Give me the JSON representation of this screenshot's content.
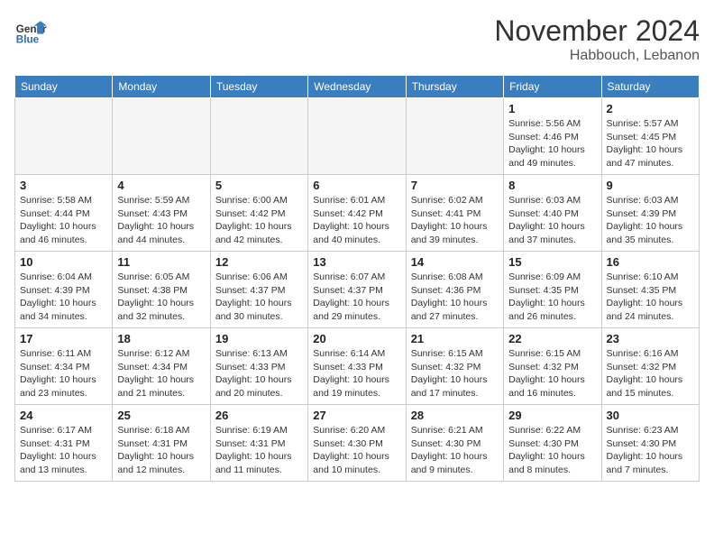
{
  "header": {
    "logo_general": "General",
    "logo_blue": "Blue",
    "month": "November 2024",
    "location": "Habbouch, Lebanon"
  },
  "days_of_week": [
    "Sunday",
    "Monday",
    "Tuesday",
    "Wednesday",
    "Thursday",
    "Friday",
    "Saturday"
  ],
  "weeks": [
    [
      {
        "day": "",
        "info": ""
      },
      {
        "day": "",
        "info": ""
      },
      {
        "day": "",
        "info": ""
      },
      {
        "day": "",
        "info": ""
      },
      {
        "day": "",
        "info": ""
      },
      {
        "day": "1",
        "info": "Sunrise: 5:56 AM\nSunset: 4:46 PM\nDaylight: 10 hours\nand 49 minutes."
      },
      {
        "day": "2",
        "info": "Sunrise: 5:57 AM\nSunset: 4:45 PM\nDaylight: 10 hours\nand 47 minutes."
      }
    ],
    [
      {
        "day": "3",
        "info": "Sunrise: 5:58 AM\nSunset: 4:44 PM\nDaylight: 10 hours\nand 46 minutes."
      },
      {
        "day": "4",
        "info": "Sunrise: 5:59 AM\nSunset: 4:43 PM\nDaylight: 10 hours\nand 44 minutes."
      },
      {
        "day": "5",
        "info": "Sunrise: 6:00 AM\nSunset: 4:42 PM\nDaylight: 10 hours\nand 42 minutes."
      },
      {
        "day": "6",
        "info": "Sunrise: 6:01 AM\nSunset: 4:42 PM\nDaylight: 10 hours\nand 40 minutes."
      },
      {
        "day": "7",
        "info": "Sunrise: 6:02 AM\nSunset: 4:41 PM\nDaylight: 10 hours\nand 39 minutes."
      },
      {
        "day": "8",
        "info": "Sunrise: 6:03 AM\nSunset: 4:40 PM\nDaylight: 10 hours\nand 37 minutes."
      },
      {
        "day": "9",
        "info": "Sunrise: 6:03 AM\nSunset: 4:39 PM\nDaylight: 10 hours\nand 35 minutes."
      }
    ],
    [
      {
        "day": "10",
        "info": "Sunrise: 6:04 AM\nSunset: 4:39 PM\nDaylight: 10 hours\nand 34 minutes."
      },
      {
        "day": "11",
        "info": "Sunrise: 6:05 AM\nSunset: 4:38 PM\nDaylight: 10 hours\nand 32 minutes."
      },
      {
        "day": "12",
        "info": "Sunrise: 6:06 AM\nSunset: 4:37 PM\nDaylight: 10 hours\nand 30 minutes."
      },
      {
        "day": "13",
        "info": "Sunrise: 6:07 AM\nSunset: 4:37 PM\nDaylight: 10 hours\nand 29 minutes."
      },
      {
        "day": "14",
        "info": "Sunrise: 6:08 AM\nSunset: 4:36 PM\nDaylight: 10 hours\nand 27 minutes."
      },
      {
        "day": "15",
        "info": "Sunrise: 6:09 AM\nSunset: 4:35 PM\nDaylight: 10 hours\nand 26 minutes."
      },
      {
        "day": "16",
        "info": "Sunrise: 6:10 AM\nSunset: 4:35 PM\nDaylight: 10 hours\nand 24 minutes."
      }
    ],
    [
      {
        "day": "17",
        "info": "Sunrise: 6:11 AM\nSunset: 4:34 PM\nDaylight: 10 hours\nand 23 minutes."
      },
      {
        "day": "18",
        "info": "Sunrise: 6:12 AM\nSunset: 4:34 PM\nDaylight: 10 hours\nand 21 minutes."
      },
      {
        "day": "19",
        "info": "Sunrise: 6:13 AM\nSunset: 4:33 PM\nDaylight: 10 hours\nand 20 minutes."
      },
      {
        "day": "20",
        "info": "Sunrise: 6:14 AM\nSunset: 4:33 PM\nDaylight: 10 hours\nand 19 minutes."
      },
      {
        "day": "21",
        "info": "Sunrise: 6:15 AM\nSunset: 4:32 PM\nDaylight: 10 hours\nand 17 minutes."
      },
      {
        "day": "22",
        "info": "Sunrise: 6:15 AM\nSunset: 4:32 PM\nDaylight: 10 hours\nand 16 minutes."
      },
      {
        "day": "23",
        "info": "Sunrise: 6:16 AM\nSunset: 4:32 PM\nDaylight: 10 hours\nand 15 minutes."
      }
    ],
    [
      {
        "day": "24",
        "info": "Sunrise: 6:17 AM\nSunset: 4:31 PM\nDaylight: 10 hours\nand 13 minutes."
      },
      {
        "day": "25",
        "info": "Sunrise: 6:18 AM\nSunset: 4:31 PM\nDaylight: 10 hours\nand 12 minutes."
      },
      {
        "day": "26",
        "info": "Sunrise: 6:19 AM\nSunset: 4:31 PM\nDaylight: 10 hours\nand 11 minutes."
      },
      {
        "day": "27",
        "info": "Sunrise: 6:20 AM\nSunset: 4:30 PM\nDaylight: 10 hours\nand 10 minutes."
      },
      {
        "day": "28",
        "info": "Sunrise: 6:21 AM\nSunset: 4:30 PM\nDaylight: 10 hours\nand 9 minutes."
      },
      {
        "day": "29",
        "info": "Sunrise: 6:22 AM\nSunset: 4:30 PM\nDaylight: 10 hours\nand 8 minutes."
      },
      {
        "day": "30",
        "info": "Sunrise: 6:23 AM\nSunset: 4:30 PM\nDaylight: 10 hours\nand 7 minutes."
      }
    ]
  ]
}
